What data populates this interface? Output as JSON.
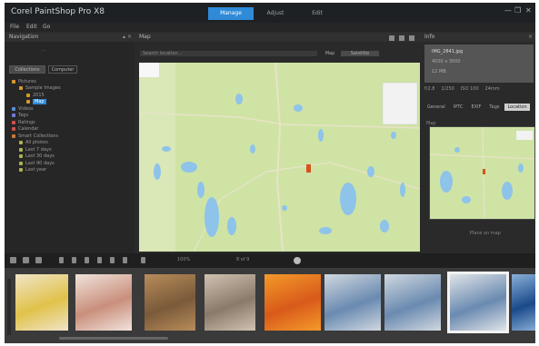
{
  "app": {
    "title": "Corel PaintShop Pro X8"
  },
  "nav_tabs": [
    {
      "label": "Manage",
      "active": true
    },
    {
      "label": "Adjust",
      "active": false
    },
    {
      "label": "Edit",
      "active": false
    }
  ],
  "window_controls": [
    "—",
    "❐",
    "✕"
  ],
  "menu": [
    "File",
    "Edit",
    "Go"
  ],
  "left_panel": {
    "title": "Navigation",
    "path": "…",
    "tabs": [
      {
        "label": "Collections",
        "active": true
      },
      {
        "label": "Computer",
        "active": false
      }
    ],
    "tree": [
      {
        "label": "Pictures",
        "level": 0,
        "icon_color": "#d99a2b",
        "selected": false
      },
      {
        "label": "Sample Images",
        "level": 1,
        "icon_color": "#d99a2b",
        "selected": false
      },
      {
        "label": "2015",
        "level": 2,
        "icon_color": "#d99a2b",
        "selected": false
      },
      {
        "label": "Map",
        "level": 2,
        "icon_color": "#d99a2b",
        "selected": true
      },
      {
        "label": "Videos",
        "level": 0,
        "icon_color": "#5b8fd6",
        "selected": false
      },
      {
        "label": "Tags",
        "level": 0,
        "icon_color": "#6f7cd6",
        "selected": false
      },
      {
        "label": "Ratings",
        "level": 0,
        "icon_color": "#d05050",
        "selected": false
      },
      {
        "label": "Calendar",
        "level": 0,
        "icon_color": "#d05050",
        "selected": false
      },
      {
        "label": "Smart Collections",
        "level": 0,
        "icon_color": "#c7783a",
        "selected": false
      },
      {
        "label": "All photos",
        "level": 1,
        "icon_color": "#b0b050",
        "selected": false
      },
      {
        "label": "Last 7 days",
        "level": 1,
        "icon_color": "#b0b050",
        "selected": false
      },
      {
        "label": "Last 30 days",
        "level": 1,
        "icon_color": "#b0b050",
        "selected": false
      },
      {
        "label": "Last 90 days",
        "level": 1,
        "icon_color": "#b0b050",
        "selected": false
      },
      {
        "label": "Last year",
        "level": 1,
        "icon_color": "#b0b050",
        "selected": false
      }
    ]
  },
  "center_panel": {
    "title": "Map",
    "address": "Search location...",
    "buttons": [
      "Map",
      "Satellite"
    ]
  },
  "right_panel": {
    "title": "Info",
    "info_lines": [
      "IMG_2841.jpg",
      "4000 x 3000",
      "12 MB"
    ],
    "info_row": [
      "f/2.8",
      "1/250",
      "ISO 100",
      "24mm"
    ],
    "tabs": [
      {
        "label": "General",
        "active": false
      },
      {
        "label": "IPTC",
        "active": false
      },
      {
        "label": "EXIF",
        "active": false
      },
      {
        "label": "Tags",
        "active": false
      },
      {
        "label": "Location",
        "active": true
      }
    ],
    "map_label": "Map",
    "footer": "Place on map"
  },
  "filmstrip_toolbar": {
    "zoom_text": "100%",
    "count_text": "8 of 9"
  },
  "thumbnails": [
    {
      "name": "portrait",
      "colors": [
        "#e0c24a",
        "#f0e4c8"
      ]
    },
    {
      "name": "food",
      "colors": [
        "#c98f7c",
        "#f1e3dc"
      ]
    },
    {
      "name": "plants",
      "colors": [
        "#7a5a3a",
        "#b88c5a"
      ]
    },
    {
      "name": "statue",
      "colors": [
        "#8a7a6a",
        "#d0c2b2"
      ]
    },
    {
      "name": "flowers",
      "colors": [
        "#d85a1a",
        "#f49a2a"
      ]
    },
    {
      "name": "city-1",
      "colors": [
        "#6a8ab0",
        "#d0d8e0"
      ]
    },
    {
      "name": "city-2",
      "colors": [
        "#6a8ab0",
        "#d0d8e0"
      ]
    },
    {
      "name": "city-3",
      "colors": [
        "#6a8ab0",
        "#e0e4e8"
      ],
      "selected": true
    },
    {
      "name": "boat",
      "colors": [
        "#1a4a8a",
        "#8ab0d8"
      ]
    }
  ],
  "colors": {
    "accent": "#2f8ad8",
    "map_land": "#cfe3a5",
    "map_water": "#8ec3ea",
    "map_pin": "#d6531f"
  }
}
